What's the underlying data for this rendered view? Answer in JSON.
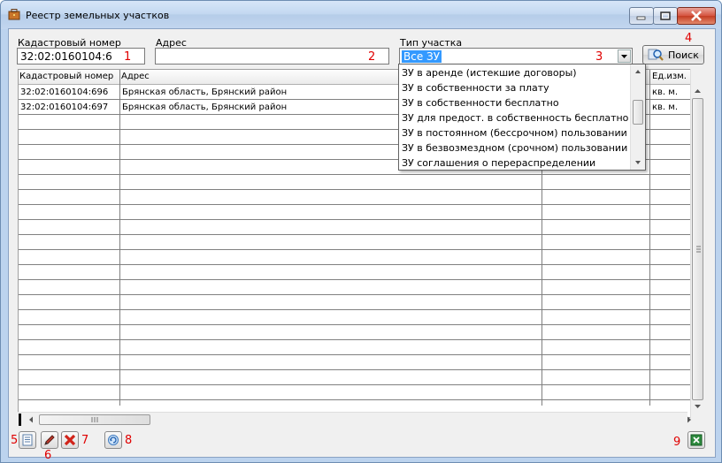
{
  "window": {
    "title": "Реестр земельных участков"
  },
  "filters": {
    "cadastral_label": "Кадастровый номер",
    "cadastral_value": "32:02:0160104:6",
    "address_label": "Адрес",
    "address_value": "",
    "type_label": "Тип участка",
    "type_value": "Все ЗУ",
    "search_label": "Поиск"
  },
  "markers": {
    "m1": "1",
    "m2": "2",
    "m3": "3",
    "m4": "4",
    "m5": "5",
    "m6": "6",
    "m7": "7",
    "m8": "8",
    "m9": "9"
  },
  "grid": {
    "columns": [
      "Кадастровый номер",
      "Адрес",
      "",
      "Ед.изм. п"
    ],
    "rows": [
      [
        "32:02:0160104:696",
        "Брянская область, Брянский район",
        "",
        "кв. м."
      ],
      [
        "32:02:0160104:697",
        "Брянская область, Брянский район",
        "",
        "кв. м."
      ]
    ]
  },
  "dropdown": {
    "options": [
      "ЗУ в аренде (истекшие договоры)",
      "ЗУ в собственности за плату",
      "ЗУ в собственности бесплатно",
      "ЗУ для предост. в собственность бесплатно",
      "ЗУ в постоянном (бессрочном) пользовании",
      "ЗУ в безвозмездном (срочном) пользовании",
      "ЗУ соглашения о перераспределении"
    ]
  },
  "icons": {
    "app": "briefcase-icon",
    "search": "magnifier-icon",
    "add": "document-icon",
    "edit": "pencil-icon",
    "delete": "red-x-icon",
    "refresh": "refresh-icon",
    "export": "excel-icon"
  },
  "colors": {
    "selection": "#3399ff",
    "marker": "#e00000",
    "titlebar": "#c3d8f1"
  }
}
